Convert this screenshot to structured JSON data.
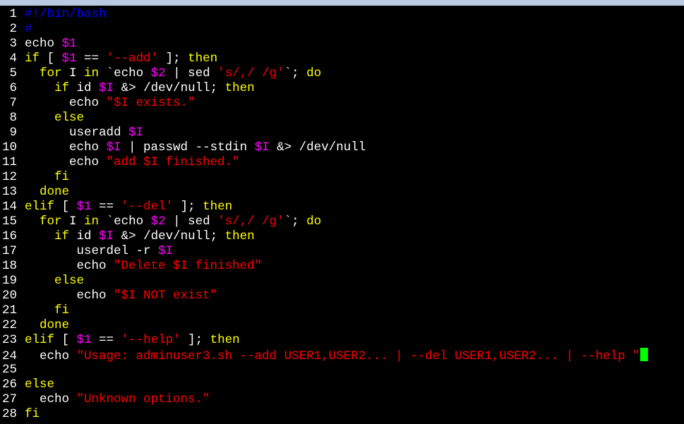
{
  "colors": {
    "background": "#000000",
    "text": "#ffffff",
    "keyword": "#ffff00",
    "variable": "#ff00ff",
    "string": "#ff0000",
    "comment": "#0000ff",
    "cursor": "#00ff00"
  },
  "editor": {
    "lines": [
      {
        "n": "1",
        "tokens": [
          [
            "#!/bin/bash",
            "comment"
          ]
        ]
      },
      {
        "n": "2",
        "tokens": [
          [
            "#",
            "comment"
          ]
        ]
      },
      {
        "n": "3",
        "tokens": [
          [
            "echo ",
            "text"
          ],
          [
            "$1",
            "variable"
          ]
        ]
      },
      {
        "n": "4",
        "tokens": [
          [
            "if ",
            "keyword"
          ],
          [
            "[ ",
            "text"
          ],
          [
            "$1",
            "variable"
          ],
          [
            " == ",
            "text"
          ],
          [
            "'--add'",
            "string"
          ],
          [
            " ]; ",
            "text"
          ],
          [
            "then",
            "keyword"
          ]
        ]
      },
      {
        "n": "5",
        "tokens": [
          [
            "  ",
            "text"
          ],
          [
            "for",
            "keyword"
          ],
          [
            " I ",
            "text"
          ],
          [
            "in",
            "keyword"
          ],
          [
            " `echo ",
            "text"
          ],
          [
            "$2",
            "variable"
          ],
          [
            " | sed ",
            "text"
          ],
          [
            "'s/,/ /g'",
            "string"
          ],
          [
            "`; ",
            "text"
          ],
          [
            "do",
            "keyword"
          ]
        ]
      },
      {
        "n": "6",
        "tokens": [
          [
            "    ",
            "text"
          ],
          [
            "if",
            "keyword"
          ],
          [
            " id ",
            "text"
          ],
          [
            "$I",
            "variable"
          ],
          [
            " &> /dev/null; ",
            "text"
          ],
          [
            "then",
            "keyword"
          ]
        ]
      },
      {
        "n": "7",
        "tokens": [
          [
            "      echo ",
            "text"
          ],
          [
            "\"$I exists.\"",
            "string"
          ]
        ]
      },
      {
        "n": "8",
        "tokens": [
          [
            "    ",
            "text"
          ],
          [
            "else",
            "keyword"
          ]
        ]
      },
      {
        "n": "9",
        "tokens": [
          [
            "      useradd ",
            "text"
          ],
          [
            "$I",
            "variable"
          ]
        ]
      },
      {
        "n": "10",
        "tokens": [
          [
            "      echo ",
            "text"
          ],
          [
            "$I",
            "variable"
          ],
          [
            " | passwd --stdin ",
            "text"
          ],
          [
            "$I",
            "variable"
          ],
          [
            " &> /dev/null",
            "text"
          ]
        ]
      },
      {
        "n": "11",
        "tokens": [
          [
            "      echo ",
            "text"
          ],
          [
            "\"add $I finished.\"",
            "string"
          ]
        ]
      },
      {
        "n": "12",
        "tokens": [
          [
            "    ",
            "text"
          ],
          [
            "fi",
            "keyword"
          ]
        ]
      },
      {
        "n": "13",
        "tokens": [
          [
            "  ",
            "text"
          ],
          [
            "done",
            "keyword"
          ]
        ]
      },
      {
        "n": "14",
        "tokens": [
          [
            "elif",
            "keyword"
          ],
          [
            " [ ",
            "text"
          ],
          [
            "$1",
            "variable"
          ],
          [
            " == ",
            "text"
          ],
          [
            "'--del'",
            "string"
          ],
          [
            " ]; ",
            "text"
          ],
          [
            "then",
            "keyword"
          ]
        ]
      },
      {
        "n": "15",
        "tokens": [
          [
            "  ",
            "text"
          ],
          [
            "for",
            "keyword"
          ],
          [
            " I ",
            "text"
          ],
          [
            "in",
            "keyword"
          ],
          [
            " `echo ",
            "text"
          ],
          [
            "$2",
            "variable"
          ],
          [
            " | sed ",
            "text"
          ],
          [
            "'s/,/ /g'",
            "string"
          ],
          [
            "`; ",
            "text"
          ],
          [
            "do",
            "keyword"
          ]
        ]
      },
      {
        "n": "16",
        "tokens": [
          [
            "    ",
            "text"
          ],
          [
            "if",
            "keyword"
          ],
          [
            " id ",
            "text"
          ],
          [
            "$I",
            "variable"
          ],
          [
            " &> /dev/null; ",
            "text"
          ],
          [
            "then",
            "keyword"
          ]
        ]
      },
      {
        "n": "17",
        "tokens": [
          [
            "       userdel -r ",
            "text"
          ],
          [
            "$I",
            "variable"
          ]
        ]
      },
      {
        "n": "18",
        "tokens": [
          [
            "       echo ",
            "text"
          ],
          [
            "\"Delete $I finished\"",
            "string"
          ]
        ]
      },
      {
        "n": "19",
        "tokens": [
          [
            "    ",
            "text"
          ],
          [
            "else",
            "keyword"
          ]
        ]
      },
      {
        "n": "20",
        "tokens": [
          [
            "       echo ",
            "text"
          ],
          [
            "\"$I NOT exist\"",
            "string"
          ]
        ]
      },
      {
        "n": "21",
        "tokens": [
          [
            "    ",
            "text"
          ],
          [
            "fi",
            "keyword"
          ]
        ]
      },
      {
        "n": "22",
        "tokens": [
          [
            "  ",
            "text"
          ],
          [
            "done",
            "keyword"
          ]
        ]
      },
      {
        "n": "23",
        "tokens": [
          [
            "elif",
            "keyword"
          ],
          [
            " [ ",
            "text"
          ],
          [
            "$1",
            "variable"
          ],
          [
            " == ",
            "text"
          ],
          [
            "'--help'",
            "string"
          ],
          [
            " ]; ",
            "text"
          ],
          [
            "then",
            "keyword"
          ]
        ]
      },
      {
        "n": "24",
        "tokens": [
          [
            "  echo ",
            "text"
          ],
          [
            "\"Usage: adminuser3.sh --add USER1,USER2... | --del USER1,USER2... | --help \"",
            "string"
          ]
        ],
        "cursor": true
      },
      {
        "n": "25",
        "tokens": []
      },
      {
        "n": "26",
        "tokens": [
          [
            "else",
            "keyword"
          ]
        ]
      },
      {
        "n": "27",
        "tokens": [
          [
            "  echo ",
            "text"
          ],
          [
            "\"Unknown options.\"",
            "string"
          ]
        ]
      },
      {
        "n": "28",
        "tokens": [
          [
            "fi",
            "keyword"
          ]
        ]
      }
    ]
  }
}
